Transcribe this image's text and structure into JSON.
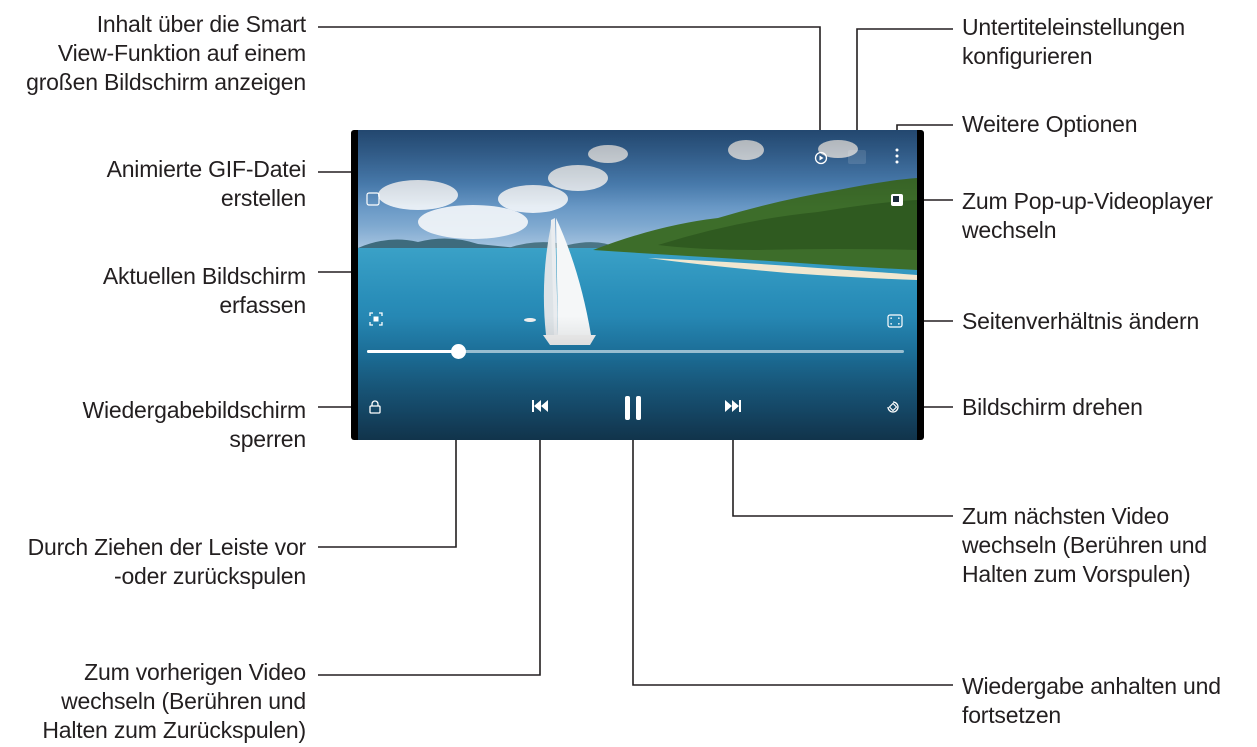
{
  "callouts": {
    "smart_view": "Inhalt über die Smart\nView-Funktion auf einem\ngroßen Bildschirm anzeigen",
    "gif": "Animierte GIF-Datei\nerstellen",
    "capture": "Aktuellen Bildschirm\nerfassen",
    "lock": "Wiedergabebildschirm\nsperren",
    "seek": "Durch Ziehen der Leiste vor\n-oder zurückspulen",
    "previous": "Zum vorherigen Video\nwechseln (Berühren und\nHalten zum Zurückspulen)",
    "subtitles": "Untertiteleinstellungen\nkonfigurieren",
    "more": "Weitere Optionen",
    "popup": "Zum Pop-up-Videoplayer\nwechseln",
    "ratio": "Seitenverhältnis ändern",
    "rotate": "Bildschirm drehen",
    "next": "Zum nächsten Video\nwechseln (Berühren und\nHalten zum Vorspulen)",
    "pause": "Wiedergabe anhalten und\nfortsetzen"
  },
  "player": {
    "progress_fraction": 0.17,
    "icons": {
      "smart_view": "smart-view-icon",
      "subtitle": "subtitle-icon",
      "more": "more-options-icon",
      "gif": "gif-icon",
      "capture": "capture-icon",
      "popup": "popup-player-icon",
      "ratio": "aspect-ratio-icon",
      "lock": "lock-icon",
      "previous": "previous-icon",
      "pause": "pause-icon",
      "next": "next-icon",
      "rotate": "rotate-icon"
    }
  },
  "colors": {
    "leader_line": "#231f20",
    "text": "#231f20",
    "player_bg": "#000000"
  }
}
